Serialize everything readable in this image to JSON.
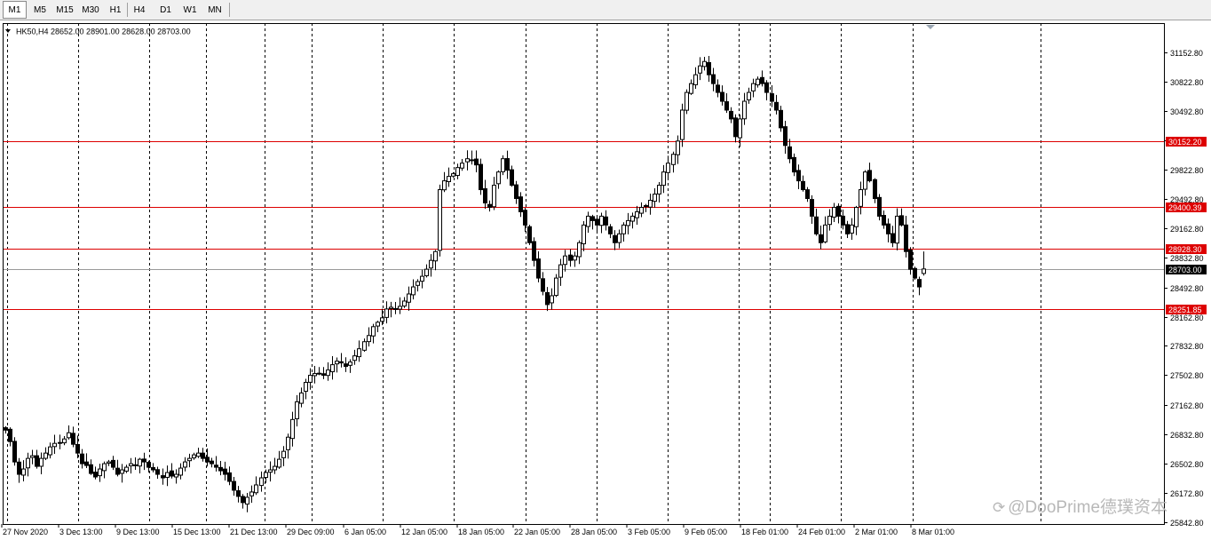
{
  "toolbar": {
    "timeframes": [
      {
        "label": "M1",
        "active": true
      },
      {
        "label": "M5",
        "active": false
      },
      {
        "label": "M15",
        "active": false
      },
      {
        "label": "M30",
        "active": false
      },
      {
        "label": "H1",
        "active": false
      },
      {
        "label": "H4",
        "active": false
      },
      {
        "label": "D1",
        "active": false
      },
      {
        "label": "W1",
        "active": false
      },
      {
        "label": "MN",
        "active": false
      }
    ]
  },
  "chart": {
    "symbol_info": "HK50,H4  28652.00 28901.00 28628.00 28703.00",
    "y_axis_labels": [
      "31152.80",
      "30822.80",
      "30492.80",
      "30162.80",
      "29822.80",
      "29492.80",
      "29162.80",
      "28832.80",
      "28492.80",
      "28162.80",
      "27832.80",
      "27502.80",
      "27162.80",
      "26832.80",
      "26502.80",
      "26172.80",
      "25842.80"
    ],
    "x_axis_labels": [
      "27 Nov 2020",
      "3 Dec 13:00",
      "9 Dec 13:00",
      "15 Dec 13:00",
      "21 Dec 13:00",
      "29 Dec 09:00",
      "6 Jan 05:00",
      "12 Jan 05:00",
      "18 Jan 05:00",
      "22 Jan 05:00",
      "28 Jan 05:00",
      "3 Feb 05:00",
      "9 Feb 05:00",
      "18 Feb 01:00",
      "24 Feb 01:00",
      "2 Mar 01:00",
      "8 Mar 01:00"
    ],
    "horizontal_lines": [
      {
        "price": 30152.2,
        "label": "30152.20",
        "color": "#dd0000"
      },
      {
        "price": 29400.39,
        "label": "29400.39",
        "color": "#dd0000"
      },
      {
        "price": 28928.3,
        "label": "28928.30",
        "color": "#dd0000"
      },
      {
        "price": 28251.85,
        "label": "28251.85",
        "color": "#dd0000"
      }
    ],
    "current_price": {
      "price": 28703.0,
      "label": "28703.00",
      "color": "#000000"
    },
    "colors": {
      "background": "#ffffff",
      "candle": "#000000",
      "grid": "#000000",
      "level": "#dd0000"
    }
  },
  "chart_data": {
    "type": "candlestick",
    "symbol": "HK50",
    "timeframe": "H4",
    "last_bar": {
      "open": 28652.0,
      "high": 28901.0,
      "low": 28628.0,
      "close": 28703.0
    },
    "ylim": [
      25842.8,
      31300.0
    ],
    "closes": [
      26880,
      26750,
      26520,
      26380,
      26440,
      26560,
      26590,
      26470,
      26560,
      26620,
      26690,
      26730,
      26740,
      26780,
      26850,
      26720,
      26620,
      26500,
      26480,
      26390,
      26350,
      26440,
      26500,
      26520,
      26460,
      26380,
      26430,
      26460,
      26500,
      26480,
      26550,
      26520,
      26460,
      26430,
      26380,
      26340,
      26400,
      26360,
      26380,
      26450,
      26520,
      26560,
      26600,
      26620,
      26560,
      26520,
      26500,
      26460,
      26420,
      26380,
      26300,
      26200,
      26130,
      26060,
      26120,
      26180,
      26260,
      26340,
      26400,
      26430,
      26470,
      26550,
      26640,
      26800,
      27000,
      27200,
      27300,
      27420,
      27500,
      27520,
      27520,
      27500,
      27560,
      27620,
      27660,
      27640,
      27600,
      27650,
      27720,
      27800,
      27880,
      27950,
      28050,
      28100,
      28150,
      28250,
      28270,
      28250,
      28280,
      28340,
      28420,
      28500,
      28560,
      28620,
      28700,
      28800,
      28900,
      29600,
      29700,
      29750,
      29780,
      29850,
      29900,
      29950,
      29930,
      29880,
      29600,
      29450,
      29400,
      29650,
      29800,
      29950,
      29820,
      29650,
      29500,
      29350,
      29200,
      29000,
      28800,
      28600,
      28450,
      28300,
      28400,
      28600,
      28750,
      28850,
      28800,
      28850,
      29000,
      29200,
      29300,
      29250,
      29200,
      29300,
      29200,
      29100,
      29000,
      29100,
      29200,
      29250,
      29300,
      29350,
      29400,
      29420,
      29480,
      29550,
      29650,
      29800,
      29900,
      30000,
      30150,
      30500,
      30700,
      30800,
      30900,
      31000,
      31050,
      30900,
      30800,
      30700,
      30600,
      30500,
      30400,
      30200,
      30400,
      30600,
      30700,
      30800,
      30850,
      30800,
      30700,
      30600,
      30500,
      30300,
      30100,
      29950,
      29800,
      29700,
      29600,
      29500,
      29300,
      29100,
      29000,
      29200,
      29300,
      29400,
      29300,
      29200,
      29100,
      29200,
      29400,
      29600,
      29800,
      29700,
      29500,
      29300,
      29200,
      29100,
      29000,
      29300,
      29200,
      28900,
      28700,
      28600,
      28500,
      28703
    ]
  }
}
